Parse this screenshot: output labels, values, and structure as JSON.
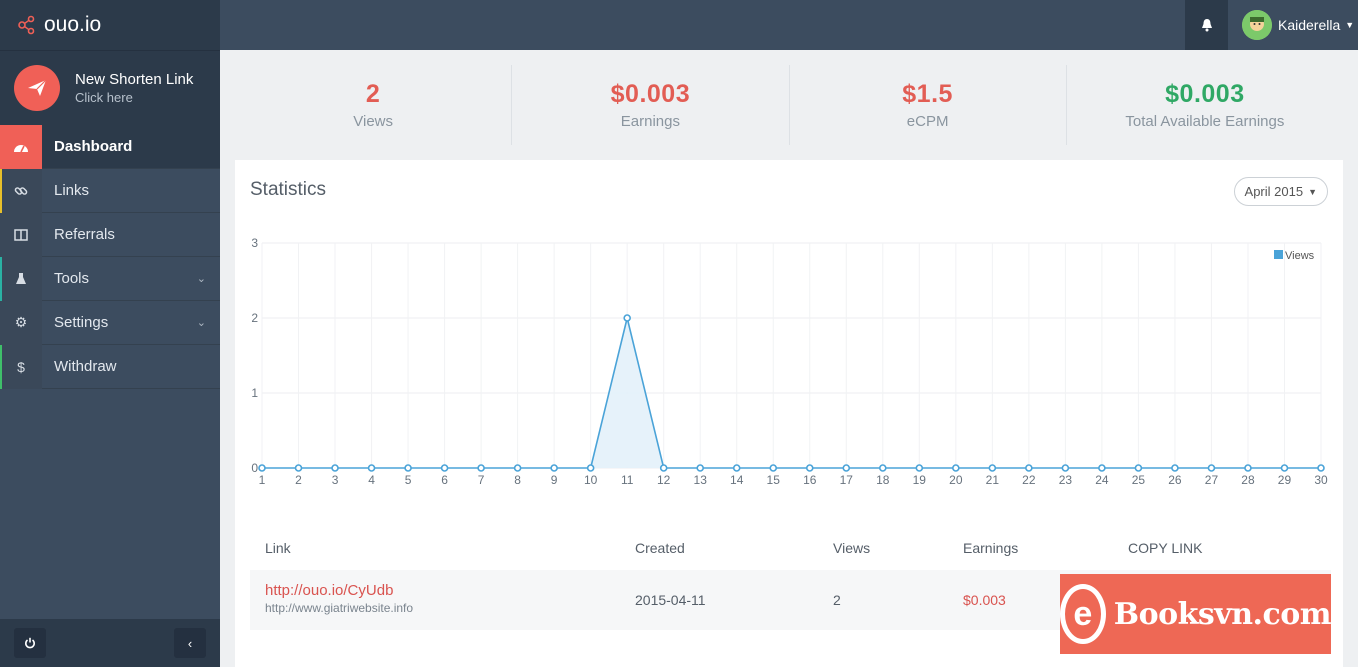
{
  "brand": {
    "name": "ouo.io"
  },
  "sidebar": {
    "shorten": {
      "title": "New Shorten Link",
      "subtitle": "Click here"
    },
    "items": [
      {
        "label": "Dashboard",
        "icon": "dashboard-icon",
        "active": true
      },
      {
        "label": "Links",
        "icon": "link-icon"
      },
      {
        "label": "Referrals",
        "icon": "columns-icon"
      },
      {
        "label": "Tools",
        "icon": "flask-icon",
        "expandable": true
      },
      {
        "label": "Settings",
        "icon": "gear-icon",
        "expandable": true
      },
      {
        "label": "Withdraw",
        "icon": "dollar-icon"
      }
    ]
  },
  "topbar": {
    "username": "Kaiderella"
  },
  "stats": [
    {
      "value": "2",
      "label": "Views"
    },
    {
      "value": "$0.003",
      "label": "Earnings"
    },
    {
      "value": "$1.5",
      "label": "eCPM"
    },
    {
      "value": "$0.003",
      "label": "Total Available Earnings"
    }
  ],
  "statistics": {
    "title": "Statistics",
    "month": "April 2015"
  },
  "chart_data": {
    "type": "area",
    "x": [
      1,
      2,
      3,
      4,
      5,
      6,
      7,
      8,
      9,
      10,
      11,
      12,
      13,
      14,
      15,
      16,
      17,
      18,
      19,
      20,
      21,
      22,
      23,
      24,
      25,
      26,
      27,
      28,
      29,
      30
    ],
    "series": [
      {
        "name": "Views",
        "values": [
          0,
          0,
          0,
          0,
          0,
          0,
          0,
          0,
          0,
          0,
          2,
          0,
          0,
          0,
          0,
          0,
          0,
          0,
          0,
          0,
          0,
          0,
          0,
          0,
          0,
          0,
          0,
          0,
          0,
          0
        ]
      }
    ],
    "yticks": [
      0,
      1,
      2,
      3
    ],
    "ylim": [
      0,
      3
    ],
    "grid": true,
    "legend": "top-right",
    "color": "#4aa3d8"
  },
  "table": {
    "headers": {
      "link": "Link",
      "created": "Created",
      "views": "Views",
      "earnings": "Earnings",
      "copy": "COPY LINK"
    },
    "rows": [
      {
        "short": "http://ouo.io/CyUdb",
        "original": "http://www.giatriwebsite.info",
        "created": "2015-04-11",
        "views": "2",
        "earnings": "$0.003"
      }
    ]
  },
  "ad": {
    "text": "Booksvn.com",
    "mark": "e"
  }
}
